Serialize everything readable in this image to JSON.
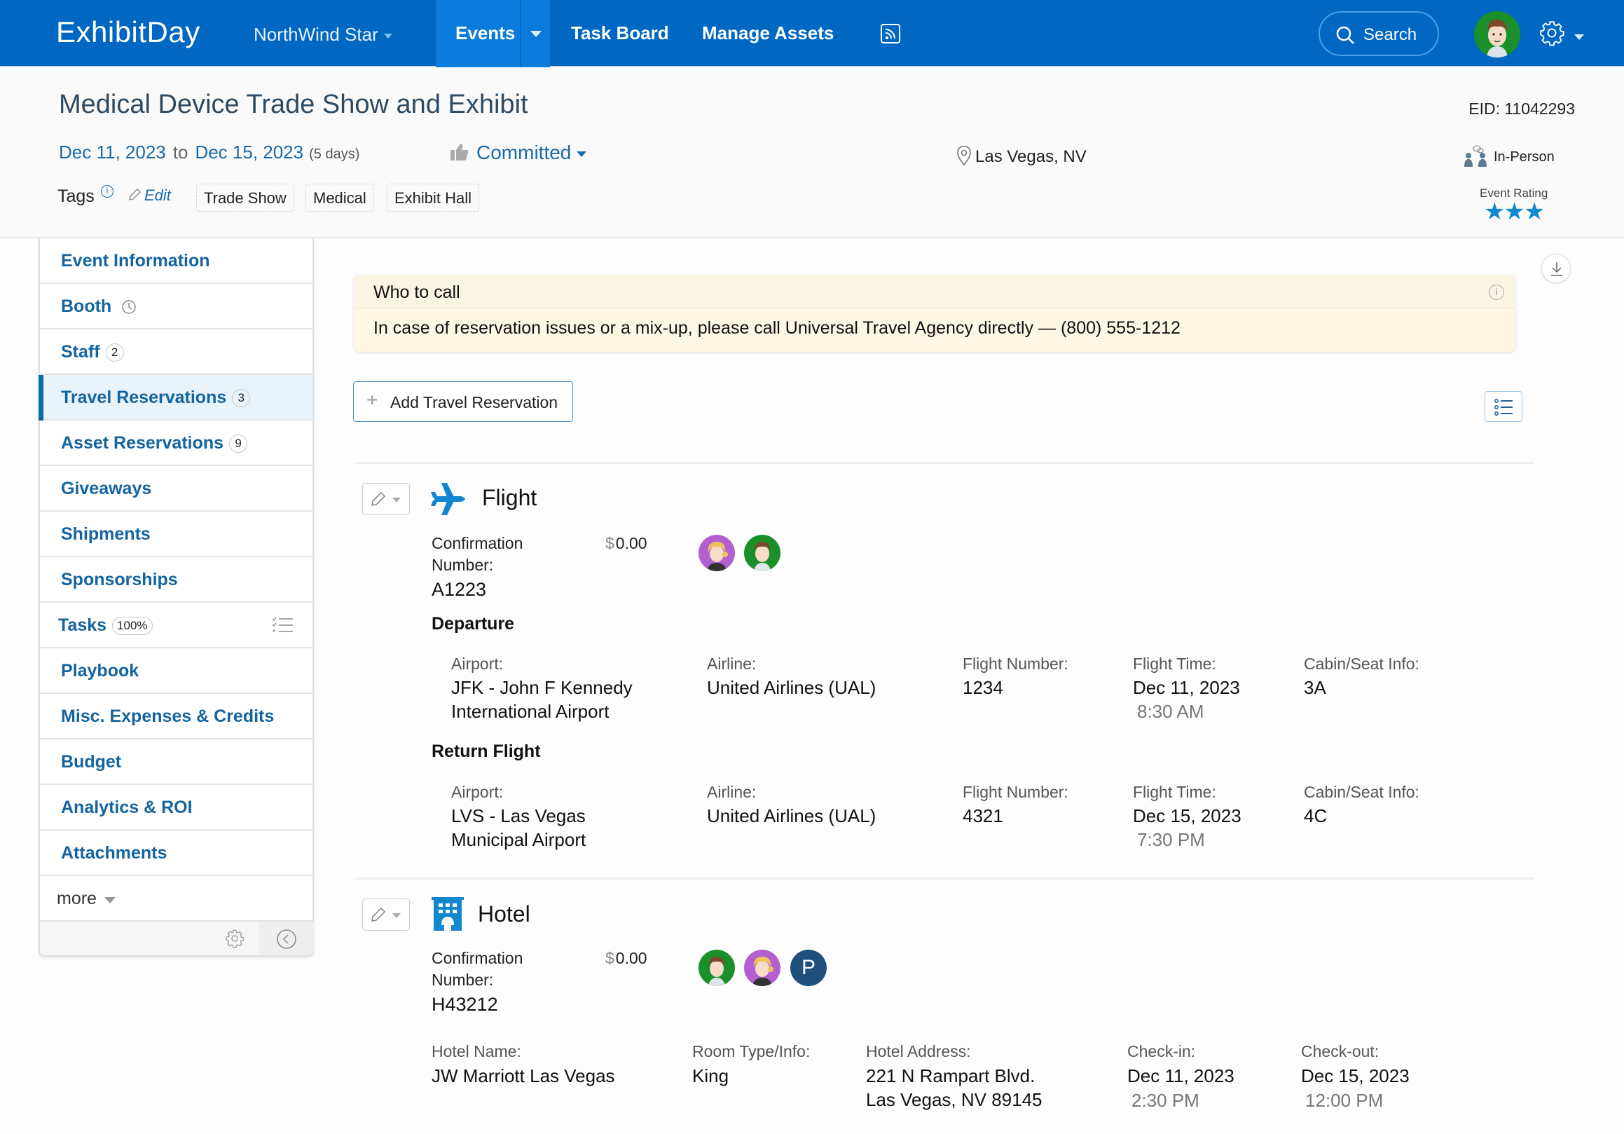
{
  "app": {
    "brand": "ExhibitDay",
    "account": "NorthWind Star",
    "nav": {
      "events": "Events",
      "task_board": "Task Board",
      "manage_assets": "Manage Assets"
    },
    "search_label": "Search"
  },
  "event": {
    "title": "Medical Device Trade Show and Exhibit",
    "eid": "EID: 11042293",
    "start_date": "Dec 11, 2023",
    "to": "to",
    "end_date": "Dec 15, 2023",
    "duration": "(5 days)",
    "status": "Committed",
    "location": "Las Vegas, NV",
    "format": "In-Person",
    "tags_label": "Tags",
    "tags_edit": "Edit",
    "tags": [
      "Trade Show",
      "Medical",
      "Exhibit Hall"
    ],
    "rating_label": "Event Rating",
    "rating": 3,
    "rating_max": 3
  },
  "sidebar": {
    "items": [
      {
        "label": "Event Information"
      },
      {
        "label": "Booth",
        "icon": "clock-icon"
      },
      {
        "label": "Staff",
        "badge": "2"
      },
      {
        "label": "Travel Reservations",
        "badge": "3",
        "active": true
      },
      {
        "label": "Asset Reservations",
        "badge": "9"
      },
      {
        "label": "Giveaways"
      },
      {
        "label": "Shipments"
      },
      {
        "label": "Sponsorships"
      },
      {
        "label": "Tasks",
        "badge": "100%",
        "icon": "task-list-icon"
      },
      {
        "label": "Playbook"
      },
      {
        "label": "Misc. Expenses & Credits"
      },
      {
        "label": "Budget"
      },
      {
        "label": "Analytics & ROI"
      },
      {
        "label": "Attachments"
      }
    ],
    "more_label": "more"
  },
  "main": {
    "callout": {
      "title": "Who to call",
      "body": "In case of reservation issues or a mix-up, please call Universal Travel Agency directly — (800) 555-1212"
    },
    "add_button": "Add Travel Reservation",
    "flight": {
      "type": "Flight",
      "confirmation_label": "Confirmation Number:",
      "confirmation": "A1223",
      "currency": "$",
      "cost": "0.00",
      "travelers": [
        "female-avatar",
        "male-avatar"
      ],
      "departure": {
        "heading": "Departure",
        "airport_label": "Airport:",
        "airport_line1": "JFK - John F Kennedy",
        "airport_line2": "International Airport",
        "airline_label": "Airline:",
        "airline": "United Airlines (UAL)",
        "flight_number_label": "Flight Number:",
        "flight_number": "1234",
        "flight_time_label": "Flight Time:",
        "flight_date": "Dec 11, 2023",
        "flight_time": "8:30 AM",
        "seat_label": "Cabin/Seat Info:",
        "seat": "3A"
      },
      "return": {
        "heading": "Return Flight",
        "airport_label": "Airport:",
        "airport_line1": "LVS - Las Vegas",
        "airport_line2": "Municipal Airport",
        "airline_label": "Airline:",
        "airline": "United Airlines (UAL)",
        "flight_number_label": "Flight Number:",
        "flight_number": "4321",
        "flight_time_label": "Flight Time:",
        "flight_date": "Dec 15, 2023",
        "flight_time": "7:30 PM",
        "seat_label": "Cabin/Seat Info:",
        "seat": "4C"
      }
    },
    "hotel": {
      "type": "Hotel",
      "confirmation_label": "Confirmation Number:",
      "confirmation": "H43212",
      "currency": "$",
      "cost": "0.00",
      "travelers": [
        "male-avatar",
        "female-avatar",
        "P"
      ],
      "name_label": "Hotel Name:",
      "name": "JW Marriott Las Vegas",
      "room_label": "Room Type/Info:",
      "room": "King",
      "address_label": "Hotel Address:",
      "address_line1": "221 N Rampart Blvd.",
      "address_line2": "Las Vegas, NV 89145",
      "checkin_label": "Check-in:",
      "checkin_date": "Dec 11, 2023",
      "checkin_time": "2:30 PM",
      "checkout_label": "Check-out:",
      "checkout_date": "Dec 15, 2023",
      "checkout_time": "12:00 PM"
    }
  },
  "colors": {
    "header_bg": "#0068c2",
    "active_tab": "#0a7bdb",
    "link": "#1464a0",
    "star": "#1187cf",
    "callout_bg": "#fdf7e4"
  }
}
